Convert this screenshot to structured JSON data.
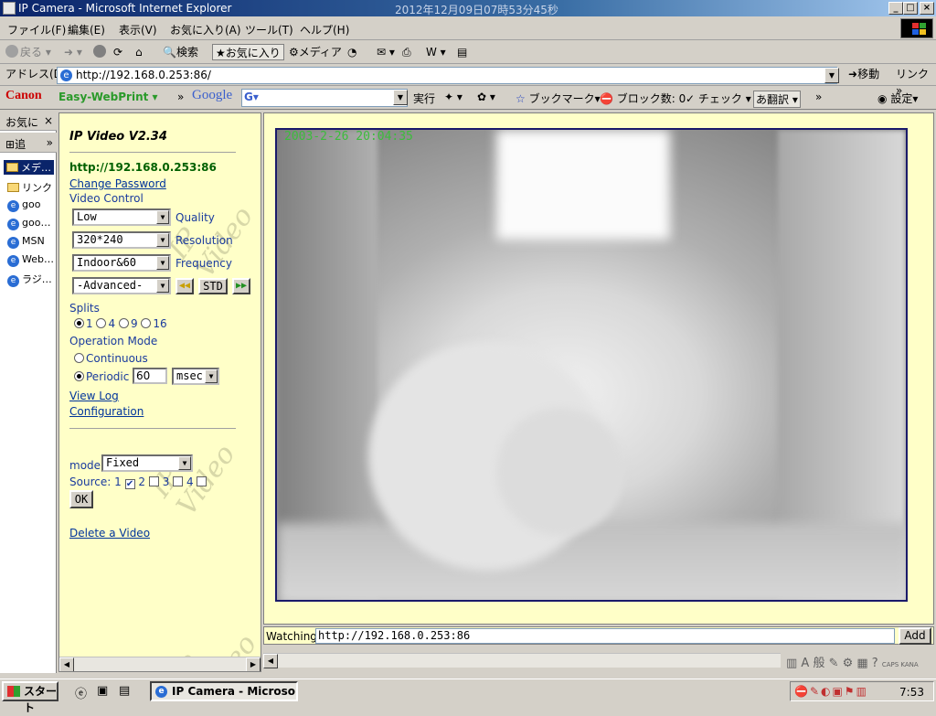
{
  "window": {
    "title": "IP Camera - Microsoft Internet Explorer",
    "datetime": "2012年12月09日07時53分45秒"
  },
  "menu": [
    "ファイル(F)",
    "編集(E)",
    "表示(V)",
    "お気に入り(A)",
    "ツール(T)",
    "ヘルプ(H)"
  ],
  "toolbar": {
    "back": "戻る",
    "search": "検索",
    "favorites": "お気に入り",
    "media": "メディア"
  },
  "address": {
    "label": "アドレス(D)",
    "url": "http://192.168.0.253:86/",
    "go": "移動",
    "links": "リンク"
  },
  "gbar": {
    "canon": "Canon",
    "ewp": "Easy-WebPrint",
    "google": "Google",
    "exec": "実行",
    "bookmarks": "ブックマーク",
    "block": "ブロック数: 0",
    "check": "チェック",
    "translate": "翻訳",
    "settings": "設定"
  },
  "favorites": {
    "header": "お気に",
    "add": "追",
    "items": [
      "メデ…",
      "リンク",
      "goo",
      "goo…",
      "MSN",
      "Web…",
      "ラジ…"
    ]
  },
  "left": {
    "title": "IP Video V2.34",
    "url": "http://192.168.0.253:86",
    "change_password": "Change Password",
    "video_control": "Video Control",
    "quality_value": "Low",
    "quality_label": "Quality",
    "resolution_value": "320*240",
    "resolution_label": "Resolution",
    "frequency_value": "Indoor&60",
    "frequency_label": "Frequency",
    "advanced_value": "-Advanced-",
    "std": "STD",
    "splits": "Splits",
    "split_options": [
      "1",
      "4",
      "9",
      "16"
    ],
    "operation_mode": "Operation Mode",
    "continuous": "Continuous",
    "periodic": "Periodic",
    "period_value": "60",
    "period_unit": "msec",
    "view_log": "View Log",
    "configuration": "Configuration",
    "mode_label": "mode:",
    "mode_value": "Fixed",
    "source_label": "Source:",
    "sources": [
      "1",
      "2",
      "3",
      "4"
    ],
    "ok": "OK",
    "delete": "Delete a Video",
    "watermark": "IP Video"
  },
  "video": {
    "timestamp": "2003-2-26 20:04:35"
  },
  "watching": {
    "label": "Watching:",
    "value": "http://192.168.0.253:86",
    "add": "Add"
  },
  "taskbar": {
    "start": "スタート",
    "task": "IP Camera - Microso...",
    "clock": "7:53"
  }
}
